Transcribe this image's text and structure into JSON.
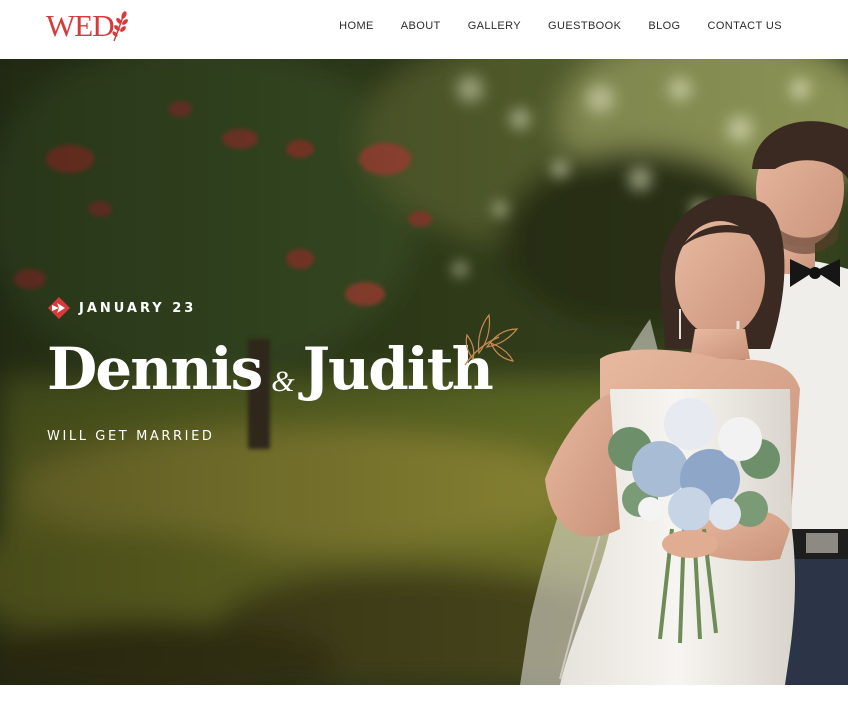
{
  "brand": {
    "logo_text": "WED",
    "logo_color": "#d8393b"
  },
  "nav": {
    "items": [
      {
        "label": "HOME"
      },
      {
        "label": "ABOUT"
      },
      {
        "label": "GALLERY"
      },
      {
        "label": "GUESTBOOK"
      },
      {
        "label": "BLOG"
      },
      {
        "label": "CONTACT US"
      }
    ]
  },
  "hero": {
    "date": "JANUARY 23",
    "name_first": "Dennis",
    "ampersand": "&",
    "name_second": "Judith",
    "tagline": "WILL GET MARRIED",
    "accent_color": "#d8393b",
    "ornament_color": "#c98a54",
    "icons": {
      "date_icon": "arrow-badge-icon",
      "ornament": "leaf-branch-icon",
      "logo_icon": "wheat-icon"
    }
  }
}
